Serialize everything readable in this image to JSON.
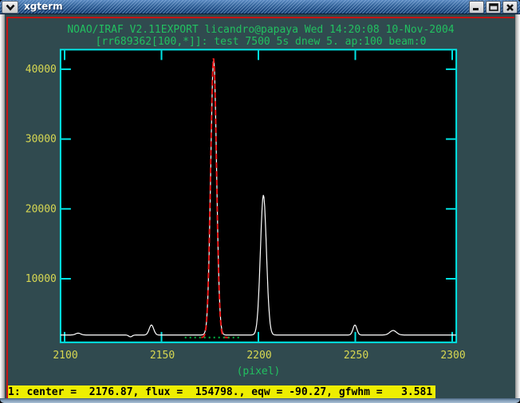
{
  "window": {
    "title": "xgterm"
  },
  "status": {
    "text": "1: center =  2176.87, flux =  154798., eqw = -90.27, gfwhm =   3.581"
  },
  "chart_data": {
    "type": "line",
    "title_lines": [
      "NOAO/IRAF V2.11EXPORT licandro@papaya Wed 14:20:08 10-Nov-2004",
      "[rr689362[100,*]]: test 7500 5s dnew 5. ap:100 beam:0"
    ],
    "xlabel": "(pixel)",
    "x_ticks": [
      2100,
      2150,
      2200,
      2250,
      2300
    ],
    "y_ticks": [
      10000,
      20000,
      30000,
      40000
    ],
    "xlim": [
      2097.9,
      2302.1
    ],
    "ylim": [
      900,
      42800
    ],
    "grid": false,
    "colors": {
      "axis": "#00e6e6",
      "tick_labels": "#d8d852",
      "titles": "#22c060",
      "spectrum": "#ffffff",
      "fit": "#e81717",
      "fit_continuum": "#00bb44",
      "plot_background": "#000000"
    },
    "series": [
      {
        "name": "spectrum",
        "color": "#ffffff",
        "style": "solid",
        "continuum": 1950,
        "gaussians": [
          [
            2107.0,
            260,
            1.3
          ],
          [
            2134.0,
            -260,
            0.9
          ],
          [
            2144.8,
            1430,
            1.15
          ],
          [
            2176.9,
            39600,
            1.5
          ],
          [
            2202.6,
            20050,
            1.55
          ],
          [
            2249.8,
            1430,
            1.0
          ],
          [
            2269.5,
            640,
            1.7
          ]
        ]
      },
      {
        "name": "gaussian-fit",
        "color": "#e81717",
        "style": "dashed",
        "continuum": 1600,
        "xrange": [
          2170.5,
          2186.8
        ],
        "gaussians": [
          [
            2176.87,
            40000,
            1.521
          ]
        ]
      },
      {
        "name": "fit-continuum",
        "color": "#00bb44",
        "style": "dotted",
        "level": 1600,
        "xrange": [
          2162.0,
          2191.5
        ]
      }
    ]
  }
}
